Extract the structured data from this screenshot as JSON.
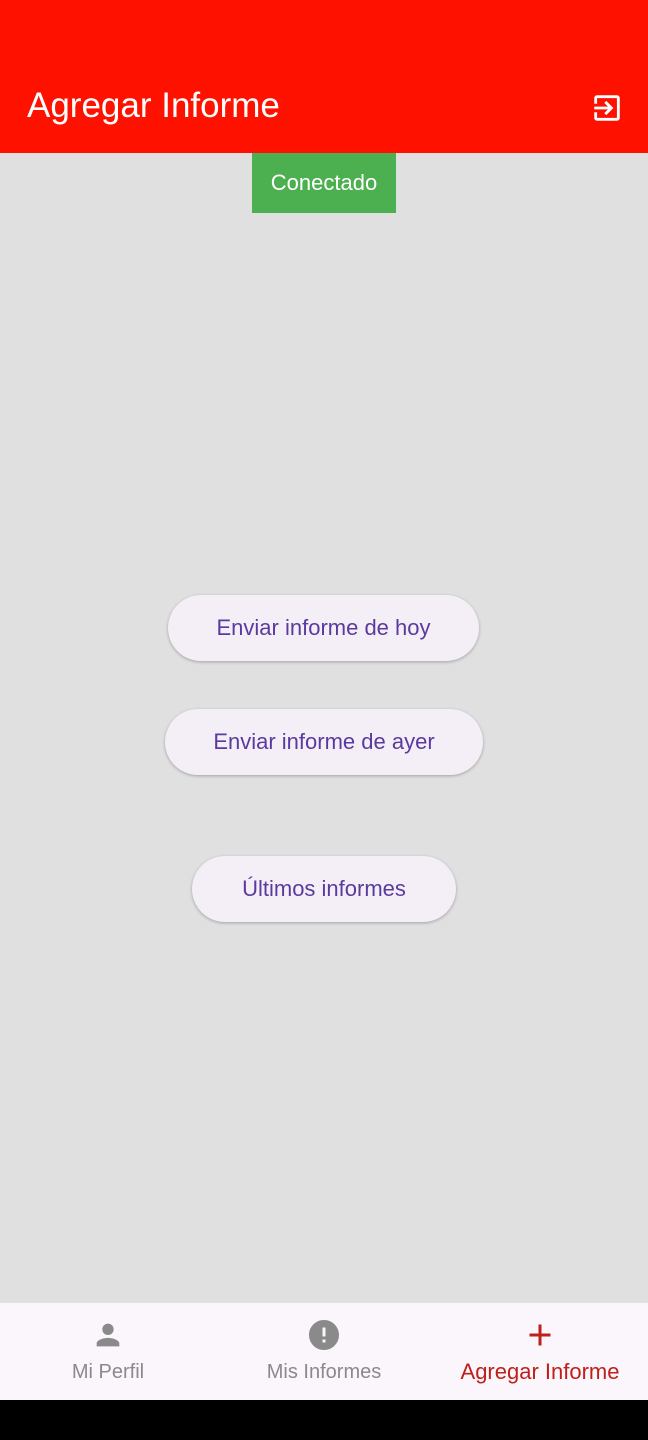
{
  "app_bar": {
    "title": "Agregar Informe",
    "logout_icon": "exit-to-app-icon",
    "background_color": "#ff1100"
  },
  "status": {
    "label": "Conectado",
    "color": "#4caf50"
  },
  "actions": {
    "send_today": "Enviar informe de hoy",
    "send_yesterday": "Enviar informe de ayer",
    "latest_reports": "Últimos informes"
  },
  "bottom_nav": {
    "items": [
      {
        "label": "Mi Perfil",
        "icon": "person-icon",
        "active": false
      },
      {
        "label": "Mis Informes",
        "icon": "alert-circle-icon",
        "active": false
      },
      {
        "label": "Agregar Informe",
        "icon": "plus-icon",
        "active": true
      }
    ],
    "active_color": "#c0201a",
    "inactive_color": "#8a8a8a"
  }
}
